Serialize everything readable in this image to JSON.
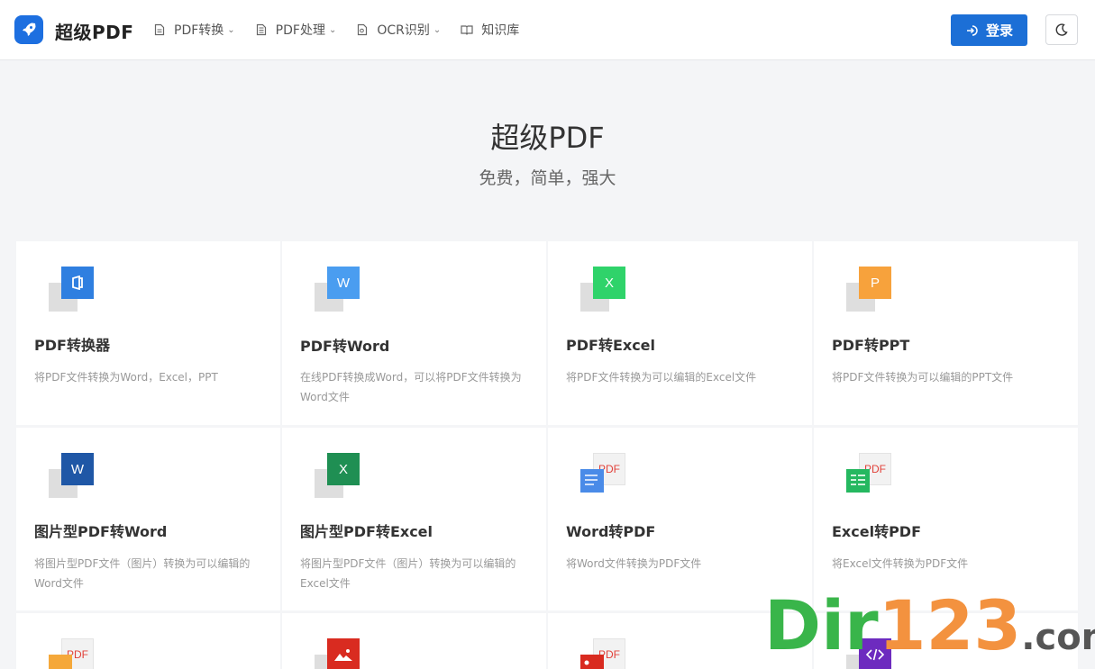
{
  "header": {
    "logo_text": "超级PDF",
    "nav": [
      {
        "label": "PDF转换",
        "has_dropdown": true
      },
      {
        "label": "PDF处理",
        "has_dropdown": true
      },
      {
        "label": "OCR识别",
        "has_dropdown": true
      },
      {
        "label": "知识库",
        "has_dropdown": false
      }
    ],
    "login_label": "登录",
    "accent": "#1c6fd6"
  },
  "hero": {
    "title": "超级PDF",
    "subtitle": "免费，简单，强大"
  },
  "cards": [
    {
      "title": "PDF转换器",
      "desc": "将PDF文件转换为Word，Excel，PPT",
      "icon": "office-icon",
      "color": "#2f7fe0"
    },
    {
      "title": "PDF转Word",
      "desc": "在线PDF转换成Word，可以将PDF文件转换为Word文件",
      "icon_letter": "W",
      "color": "#4a9df0"
    },
    {
      "title": "PDF转Excel",
      "desc": "将PDF文件转换为可以编辑的Excel文件",
      "icon_letter": "X",
      "color": "#2fd36a"
    },
    {
      "title": "PDF转PPT",
      "desc": "将PDF文件转换为可以编辑的PPT文件",
      "icon_letter": "P",
      "color": "#f7a23c"
    },
    {
      "title": "图片型PDF转Word",
      "desc": "将图片型PDF文件（图片）转换为可以编辑的Word文件",
      "icon_letter": "W",
      "color": "#1f57a6"
    },
    {
      "title": "图片型PDF转Excel",
      "desc": "将图片型PDF文件（图片）转换为可以编辑的Excel文件",
      "icon_letter": "X",
      "color": "#1f8f53"
    },
    {
      "title": "Word转PDF",
      "desc": "将Word文件转换为PDF文件",
      "icon_letter": "PDF",
      "color": "#4a8be8"
    },
    {
      "title": "Excel转PDF",
      "desc": "将Excel文件转换为PDF文件",
      "icon_letter": "PDF",
      "color": "#25b860"
    },
    {
      "title": "",
      "desc": "",
      "icon_letter": "PDF",
      "color": "#f5a83a"
    },
    {
      "title": "",
      "desc": "",
      "icon": "image-icon",
      "color": "#d92b20"
    },
    {
      "title": "",
      "desc": "",
      "icon_letter": "PDF",
      "color": "#d92b20"
    },
    {
      "title": "",
      "desc": "",
      "icon": "code-icon",
      "color": "#6d2bbf"
    }
  ],
  "watermark": {
    "part1": "Dir",
    "part2": "123",
    "part3": ".com"
  }
}
